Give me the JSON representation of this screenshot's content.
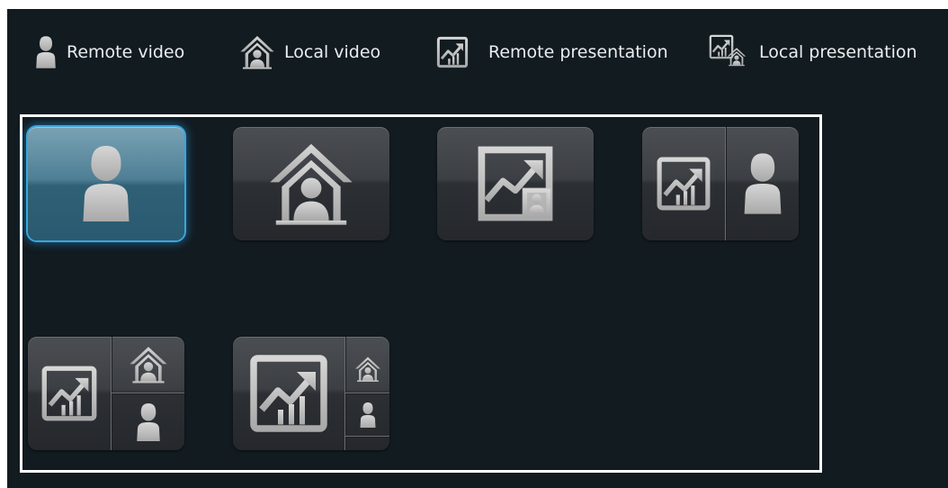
{
  "legend": [
    {
      "label": "Remote video",
      "icon": "person-icon"
    },
    {
      "label": "Local video",
      "icon": "house-person-icon"
    },
    {
      "label": "Remote presentation",
      "icon": "presentation-chart-icon"
    },
    {
      "label": "Local presentation",
      "icon": "presentation-house-icon"
    }
  ],
  "layouts": [
    {
      "name": "Remote video full screen",
      "selected": true
    },
    {
      "name": "Local video full screen",
      "selected": false
    },
    {
      "name": "Remote presentation with local inset",
      "selected": false
    },
    {
      "name": "Presentation and remote video side by side",
      "selected": false
    },
    {
      "name": "Presentation with local and remote stacked",
      "selected": false
    },
    {
      "name": "Large presentation with small local and remote",
      "selected": false
    }
  ],
  "colors": {
    "background": "#121b20",
    "frame": "#ffffff",
    "selected": "#3aa6dc",
    "icon": "#c8c8c8"
  }
}
